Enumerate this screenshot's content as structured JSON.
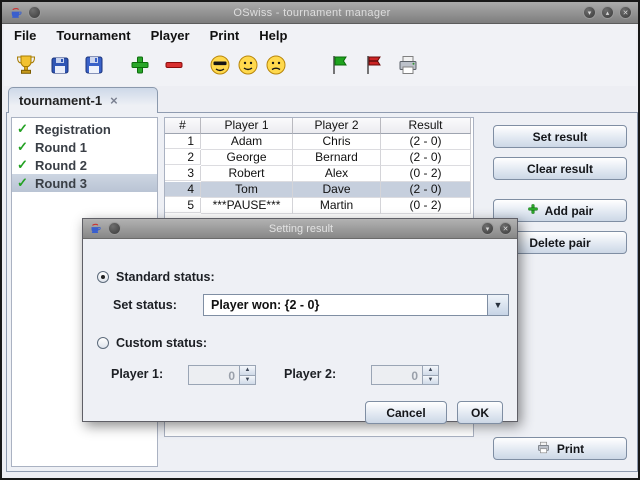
{
  "window": {
    "title": "OSwiss - tournament manager"
  },
  "menu": {
    "items": [
      {
        "label": "File"
      },
      {
        "label": "Tournament"
      },
      {
        "label": "Player"
      },
      {
        "label": "Print"
      },
      {
        "label": "Help"
      }
    ]
  },
  "tabs": {
    "active": {
      "label": "tournament-1"
    }
  },
  "sidebar": {
    "items": [
      {
        "label": "Registration"
      },
      {
        "label": "Round 1"
      },
      {
        "label": "Round 2"
      },
      {
        "label": "Round 3"
      }
    ],
    "selected_index": 3
  },
  "table": {
    "headers": [
      "#",
      "Player 1",
      "Player 2",
      "Result"
    ],
    "rows": [
      [
        "1",
        "Adam",
        "Chris",
        "(2 - 0)"
      ],
      [
        "2",
        "George",
        "Bernard",
        "(2 - 0)"
      ],
      [
        "3",
        "Robert",
        "Alex",
        "(0 - 2)"
      ],
      [
        "4",
        "Tom",
        "Dave",
        "(2 - 0)"
      ],
      [
        "5",
        "***PAUSE***",
        "Martin",
        "(0 - 2)"
      ]
    ],
    "selected_row": "4"
  },
  "actions": {
    "set_result": "Set result",
    "clear_result": "Clear result",
    "add_pair": "Add pair",
    "delete_pair": "Delete pair",
    "print": "Print"
  },
  "dialog": {
    "title": "Setting result",
    "standard_status_label": "Standard status:",
    "set_status_label": "Set status:",
    "status_value": "Player won: {2 - 0}",
    "custom_status_label": "Custom status:",
    "player1_label": "Player 1:",
    "player1_value": "0",
    "player2_label": "Player 2:",
    "player2_value": "0",
    "cancel": "Cancel",
    "ok": "OK"
  },
  "icons": {
    "check": "✓",
    "tab_close": "×",
    "combo_arrow": "▼",
    "spin_up": "▲",
    "spin_down": "▼",
    "window_min": "▾",
    "window_max": "▴",
    "window_close": "✕",
    "dialog_min": "▾",
    "dialog_close": "✕"
  },
  "colors": {
    "selection": "#c6cfdd",
    "check_green": "#23a123",
    "titlebar_gray": "#8f8f8f"
  }
}
